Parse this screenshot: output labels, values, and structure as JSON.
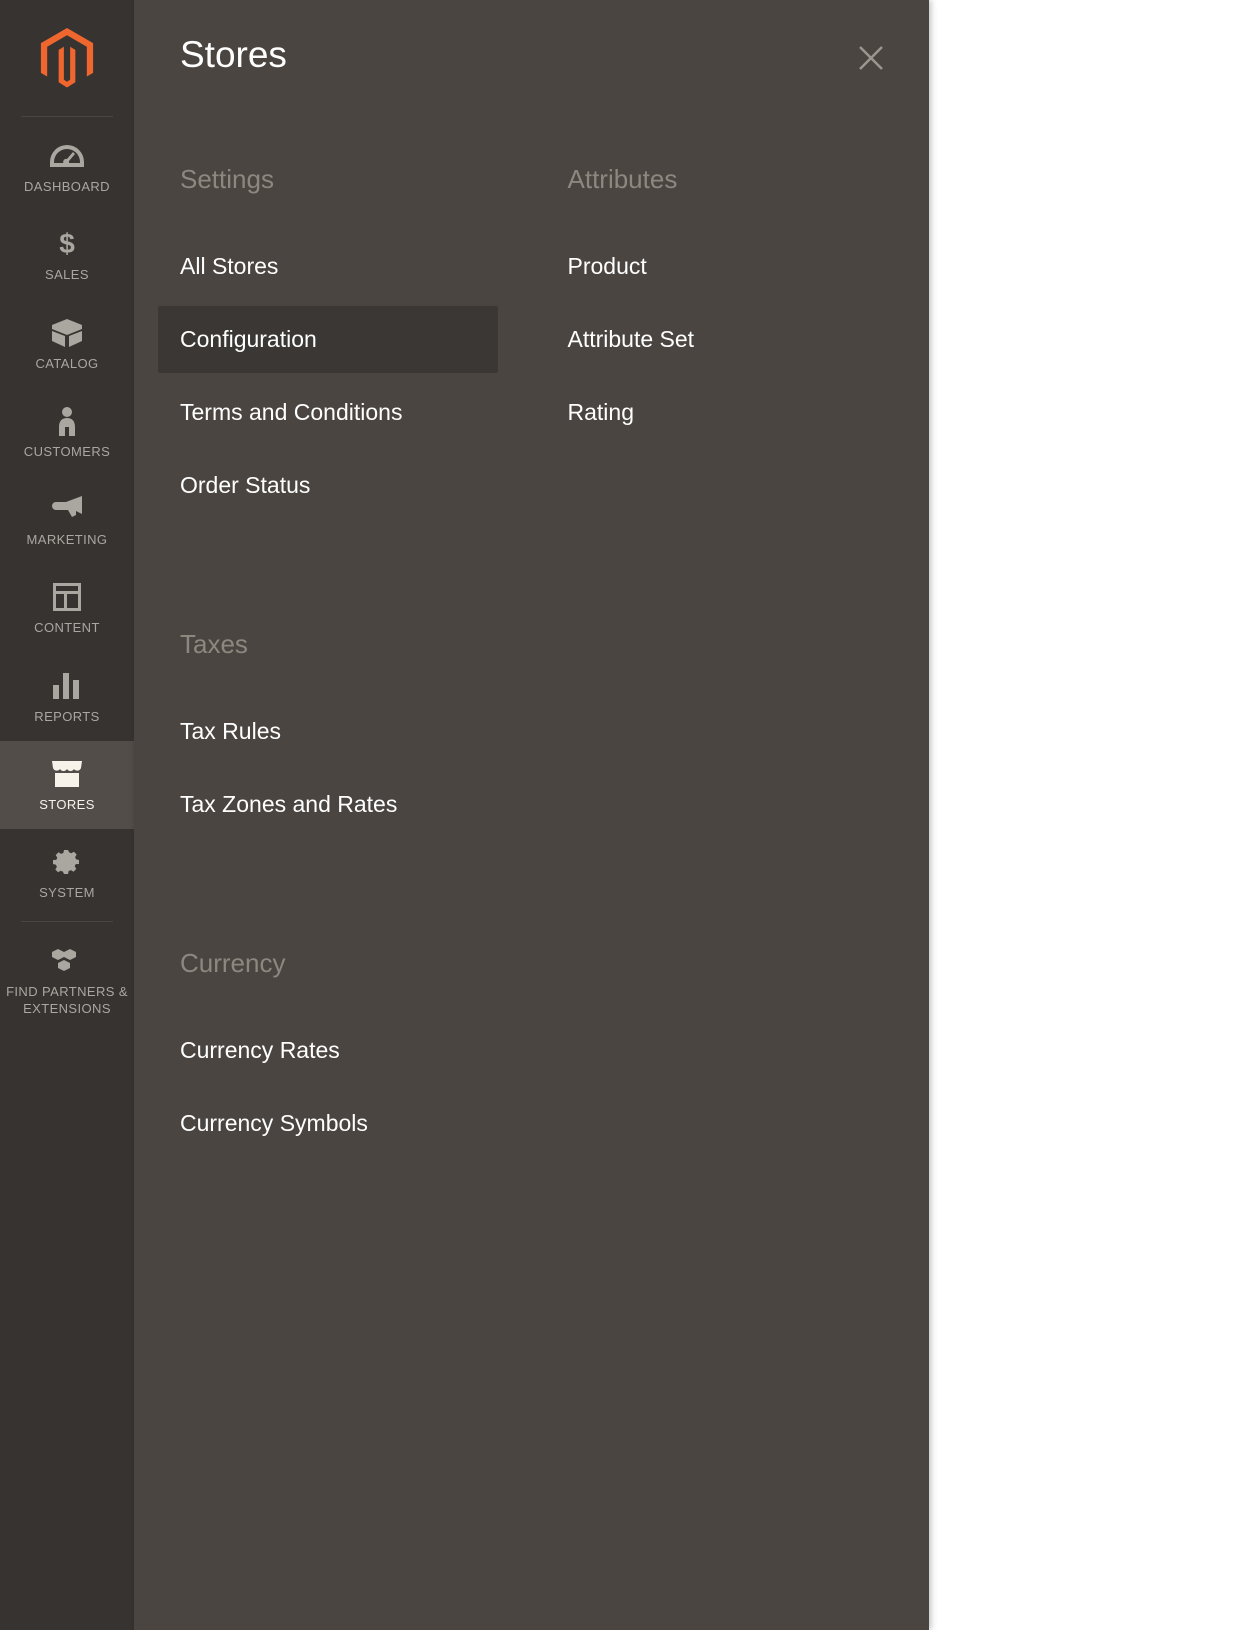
{
  "nav": {
    "items": [
      {
        "label": "DASHBOARD"
      },
      {
        "label": "SALES"
      },
      {
        "label": "CATALOG"
      },
      {
        "label": "CUSTOMERS"
      },
      {
        "label": "MARKETING"
      },
      {
        "label": "CONTENT"
      },
      {
        "label": "REPORTS"
      },
      {
        "label": "STORES"
      },
      {
        "label": "SYSTEM"
      },
      {
        "label": "FIND PARTNERS & EXTENSIONS"
      }
    ],
    "active_index": 7
  },
  "flyout": {
    "title": "Stores",
    "columns": [
      {
        "sections": [
          {
            "title": "Settings",
            "links": [
              {
                "label": "All Stores"
              },
              {
                "label": "Configuration",
                "active": true
              },
              {
                "label": "Terms and Conditions"
              },
              {
                "label": "Order Status"
              }
            ]
          },
          {
            "title": "Taxes",
            "links": [
              {
                "label": "Tax Rules"
              },
              {
                "label": "Tax Zones and Rates"
              }
            ]
          },
          {
            "title": "Currency",
            "links": [
              {
                "label": "Currency Rates"
              },
              {
                "label": "Currency Symbols"
              }
            ]
          }
        ]
      },
      {
        "sections": [
          {
            "title": "Attributes",
            "links": [
              {
                "label": "Product"
              },
              {
                "label": "Attribute Set"
              },
              {
                "label": "Rating"
              }
            ]
          }
        ]
      }
    ]
  },
  "colors": {
    "brand_orange": "#ef672f",
    "nav_bg": "#373330",
    "flyout_bg": "#4a4541"
  }
}
